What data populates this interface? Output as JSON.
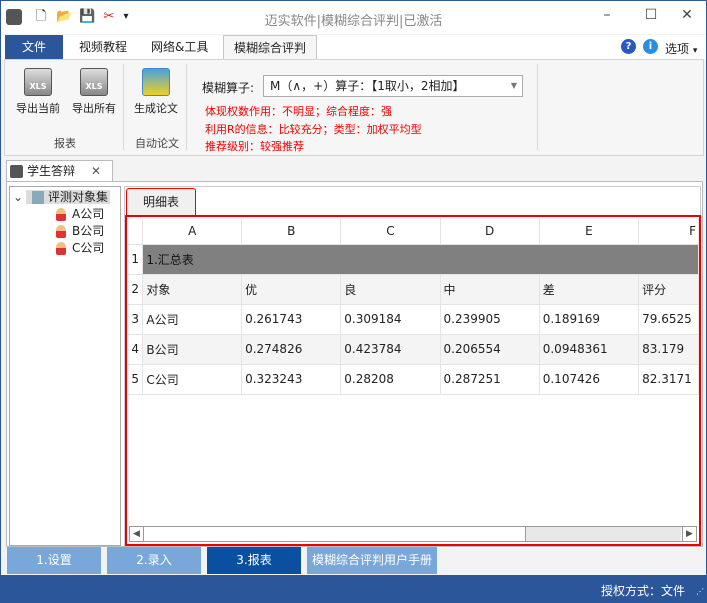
{
  "window": {
    "title": "迈实软件|模糊综合评判|已激活",
    "minimize": "–",
    "maximize": "☐",
    "close": "✕"
  },
  "quick_access": {
    "new": "🗋",
    "open": "📂",
    "save": "💾",
    "tools": "✂",
    "more": "▾"
  },
  "ribbon_tabs": [
    {
      "label": "文件"
    },
    {
      "label": "视频教程"
    },
    {
      "label": "网络&工具"
    },
    {
      "label": "模糊综合评判"
    }
  ],
  "help": {
    "help_icon": "?",
    "info_icon": "i",
    "options": "选项",
    "options_arrow": "▾"
  },
  "ribbon": {
    "export_current": "导出当前",
    "export_all": "导出所有",
    "group_report": "报表",
    "generate_paper": "生成论文",
    "group_auto": "自动论文",
    "operator_label": "模糊算子:",
    "operator_value": "M（∧，+）算子：【1取小，2相加】",
    "info": [
      "体现权数作用：不明显；综合程度：强",
      "利用R的信息：比较充分；类型：加权平均型",
      "推荐级别：较强推荐"
    ]
  },
  "doc_tab": {
    "label": "学生答辩",
    "close": "✕"
  },
  "tree": {
    "root": "评测对象集",
    "expand": "⌄",
    "children": [
      "A公司",
      "B公司",
      "C公司"
    ]
  },
  "inner_tab": "明细表",
  "grid": {
    "columns": [
      "A",
      "B",
      "C",
      "D",
      "E",
      "F"
    ],
    "title_row": "1.汇总表",
    "header": [
      "对象",
      "优",
      "良",
      "中",
      "差",
      "评分"
    ],
    "rows": [
      [
        "A公司",
        "0.261743",
        "0.309184",
        "0.239905",
        "0.189169",
        "79.6525"
      ],
      [
        "B公司",
        "0.274826",
        "0.423784",
        "0.206554",
        "0.0948361",
        "83.179"
      ],
      [
        "C公司",
        "0.323243",
        "0.28208",
        "0.287251",
        "0.107426",
        "82.3171"
      ]
    ],
    "row_numbers": [
      "1",
      "2",
      "3",
      "4",
      "5"
    ]
  },
  "bottom_tabs": [
    {
      "label": "1.设置"
    },
    {
      "label": "2.录入"
    },
    {
      "label": "3.报表"
    },
    {
      "label": "模糊综合评判用户手册"
    }
  ],
  "status": {
    "text": "授权方式：文件"
  },
  "colors": {
    "accent": "#2b579a",
    "active_bottom_tab": "#0a4fa0",
    "inactive_bottom_tab": "#7aa7d9",
    "highlight": "#ee0000"
  }
}
